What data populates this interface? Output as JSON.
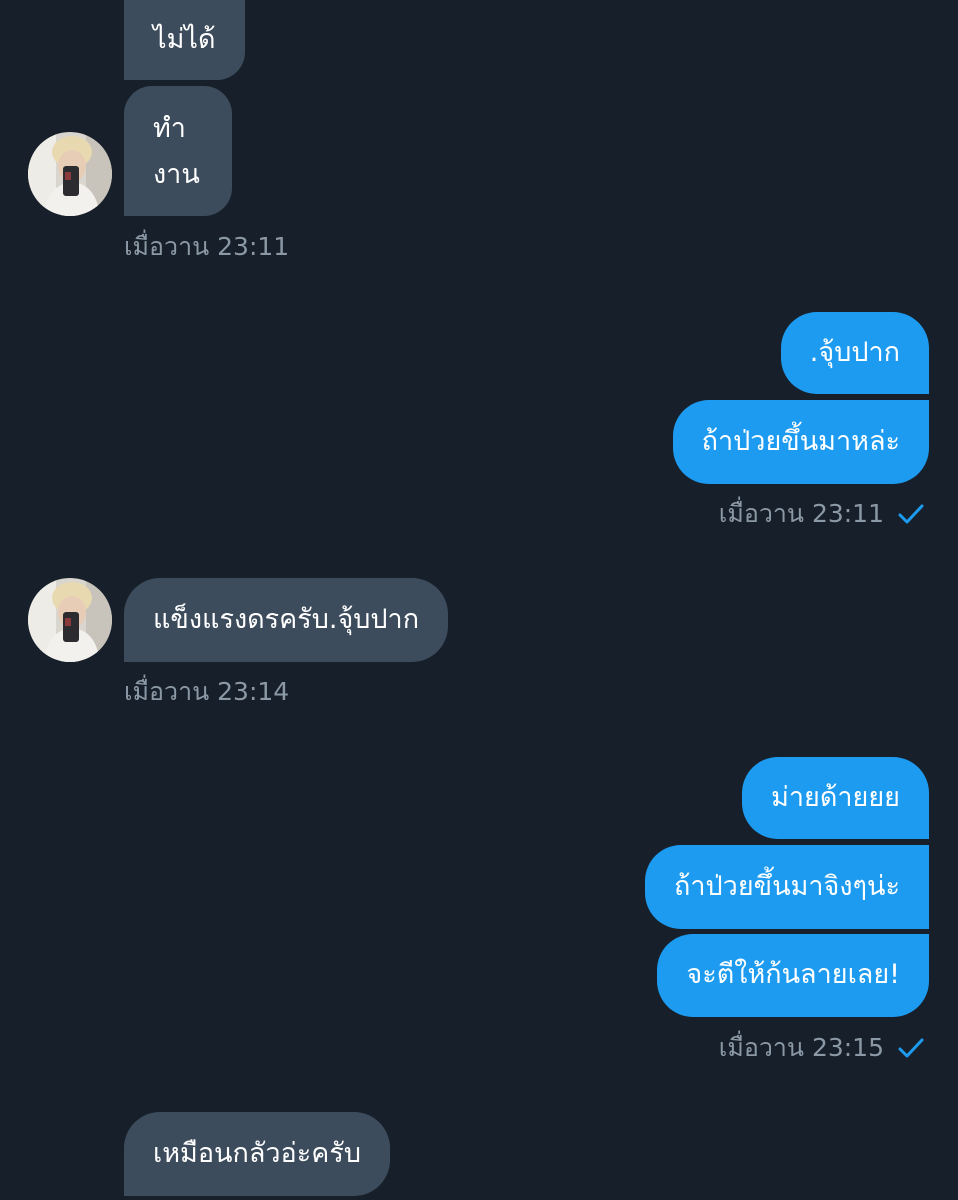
{
  "conversation": {
    "group1": {
      "messages": [
        "ไม่ได้",
        "ทำ",
        "งาน"
      ],
      "timestamp": "เมื่อวาน 23:11"
    },
    "group2": {
      "messages": [
        ".จุ้บปาก",
        "ถ้าป่วยขึ้นมาหล่ะ"
      ],
      "timestamp": "เมื่อวาน 23:11"
    },
    "group3": {
      "messages": [
        "แข็งแรงดรครับ.จุ้บปาก"
      ],
      "timestamp": "เมื่อวาน 23:14"
    },
    "group4": {
      "messages": [
        "ม่ายด้ายยย",
        "ถ้าป่วยขึ้นมาจิงๆน่ะ",
        "จะตีให้ก้นลายเลย!"
      ],
      "timestamp": "เมื่อวาน 23:15"
    },
    "group5": {
      "messages": [
        "เหมือนกลัวอ่ะครับ"
      ]
    }
  },
  "icons": {
    "read_receipt": "check-icon",
    "avatar": "avatar"
  },
  "colors": {
    "background": "#17202a",
    "received_bubble": "#3d4c5c",
    "sent_bubble": "#1d9bf0",
    "timestamp_text": "#8b98a5",
    "check": "#1d9bf0"
  }
}
